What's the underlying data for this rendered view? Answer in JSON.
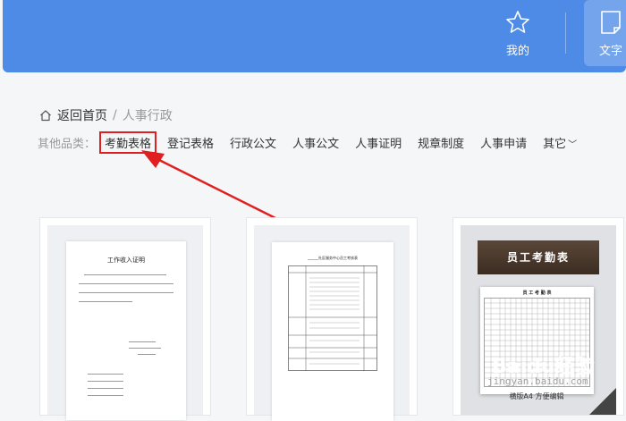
{
  "header": {
    "nav": [
      {
        "label": "我的",
        "icon": "star-icon"
      },
      {
        "label": "文字",
        "icon": "document-icon"
      }
    ]
  },
  "breadcrumb": {
    "home_label": "返回首页",
    "separator": "/",
    "current": "人事行政"
  },
  "categories": {
    "label": "其他品类：",
    "items": [
      "考勤表格",
      "登记表格",
      "行政公文",
      "人事公文",
      "人事证明",
      "规章制度",
      "人事申请",
      "其它"
    ],
    "active": "考勤表格"
  },
  "cards": [
    {
      "doc_title": "工作收入证明"
    },
    {
      "doc_title": "______社区服务中心员工考核表"
    },
    {
      "banner_title": "员工考勤表",
      "sheet_title": "员 工 考 勤 表",
      "footer": "横版A4  方便编辑"
    }
  ],
  "watermark": {
    "brand": "Baidu经验",
    "url": "jingyan.baidu.com"
  },
  "colors": {
    "accent": "#4d8be6",
    "highlight": "#e02020"
  }
}
